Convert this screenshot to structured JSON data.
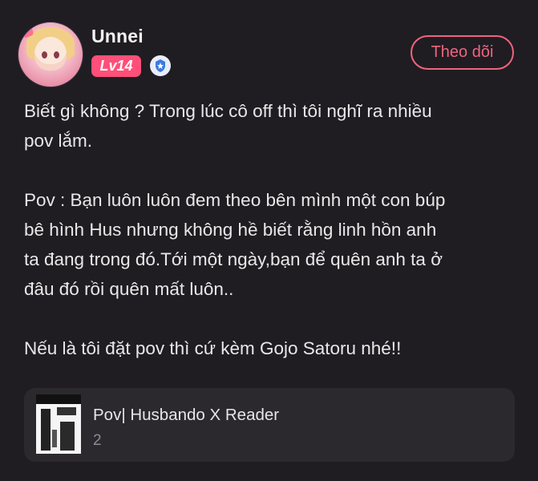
{
  "post": {
    "author": {
      "name": "Unnei",
      "level": "Lv14",
      "verified_icon": "shield-star-icon"
    },
    "follow_label": "Theo dõi",
    "paragraphs": [
      "Biết gì không ? Trong lúc cô off thì tôi nghĩ ra nhiều\npov lắm.",
      "Pov : Bạn luôn luôn đem theo bên mình một con búp\nbê hình Hus nhưng không hề biết rằng linh hồn anh\nta đang trong đó.Tới một ngày,bạn để quên anh ta ở\nđâu đó rồi quên mất luôn..",
      "Nếu là tôi đặt pov thì cứ kèm Gojo Satoru nhé!!"
    ],
    "linked_story": {
      "title": "Pov| Husbando X Reader",
      "count": "2"
    }
  },
  "colors": {
    "background": "#1f1d22",
    "accent": "#f0647f",
    "level_badge": "#ff4f78",
    "card": "#2b292e"
  }
}
